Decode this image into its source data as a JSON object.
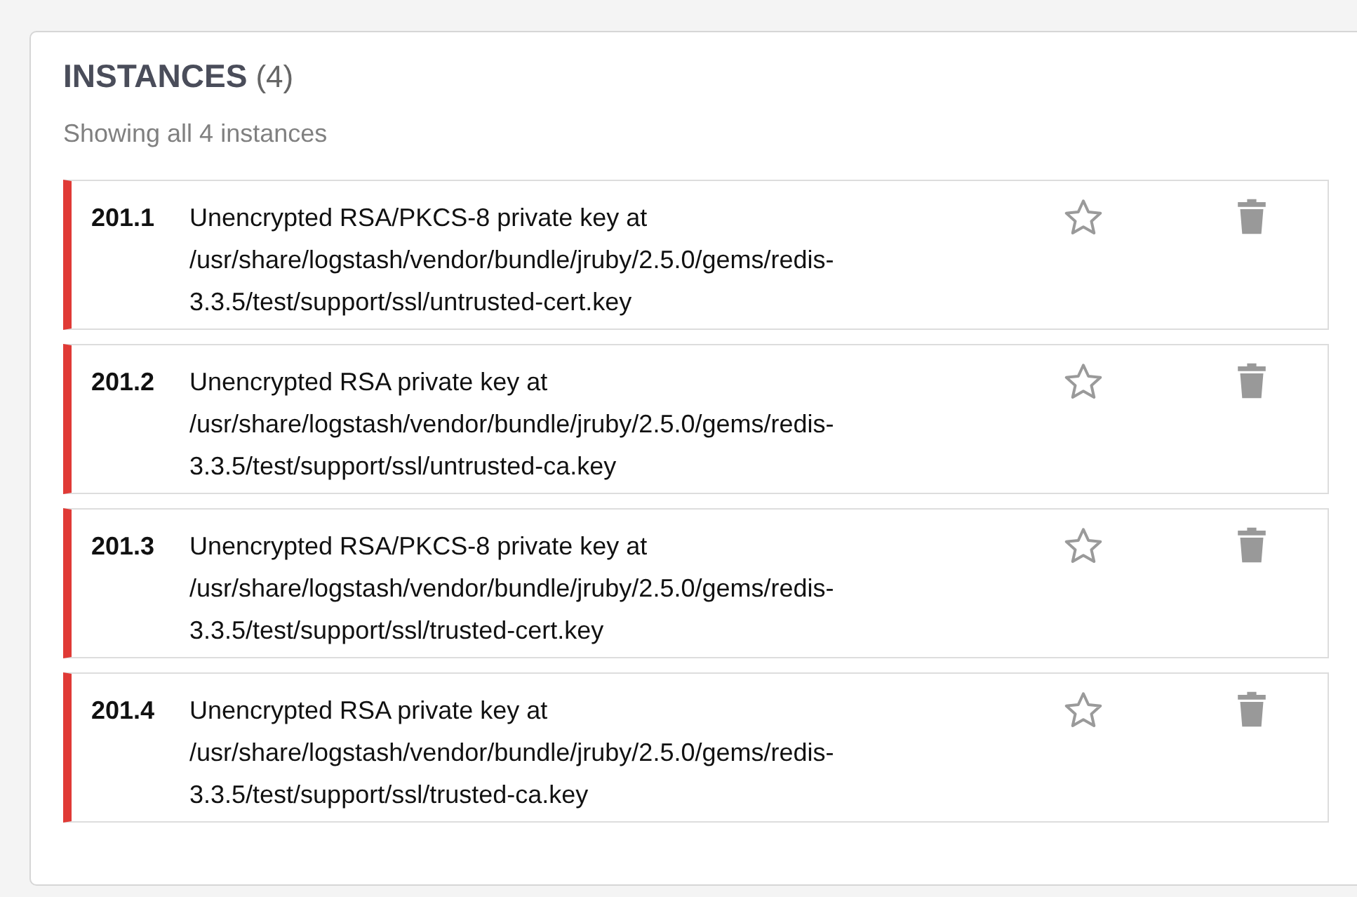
{
  "panel": {
    "title": "INSTANCES",
    "count": "(4)",
    "subtitle": "Showing all 4 instances"
  },
  "instances": [
    {
      "id": "201.1",
      "lines": [
        "Unencrypted RSA/PKCS-8 private key at",
        "/usr/share/logstash/vendor/bundle/jruby/2.5.0/gems/redis-",
        "3.3.5/test/support/ssl/untrusted-cert.key"
      ],
      "starred": false
    },
    {
      "id": "201.2",
      "lines": [
        "Unencrypted RSA private key at",
        "/usr/share/logstash/vendor/bundle/jruby/2.5.0/gems/redis-",
        "3.3.5/test/support/ssl/untrusted-ca.key"
      ],
      "starred": false
    },
    {
      "id": "201.3",
      "lines": [
        "Unencrypted RSA/PKCS-8 private key at",
        "/usr/share/logstash/vendor/bundle/jruby/2.5.0/gems/redis-",
        "3.3.5/test/support/ssl/trusted-cert.key"
      ],
      "starred": false
    },
    {
      "id": "201.4",
      "lines": [
        "Unencrypted RSA private key at",
        "/usr/share/logstash/vendor/bundle/jruby/2.5.0/gems/redis-",
        "3.3.5/test/support/ssl/trusted-ca.key"
      ],
      "starred": false
    }
  ]
}
